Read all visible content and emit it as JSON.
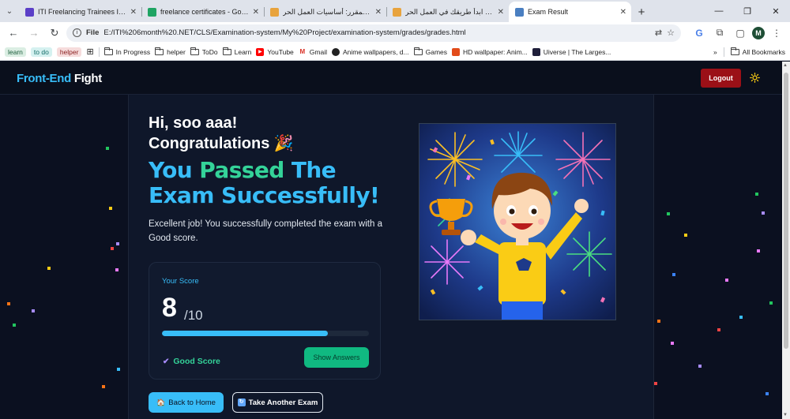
{
  "browser": {
    "tabs": [
      {
        "title": "ITI Freelancing Trainees Info an",
        "favicon_color": "#5b3fc7",
        "active": false
      },
      {
        "title": "freelance certificates - Google D",
        "favicon_color": "#1fa463",
        "active": false
      },
      {
        "title": "المقرر: أساسيات العمل الحر | Tech",
        "favicon_color": "#e8a33d",
        "active": false
      },
      {
        "title": "المقرر: ابدأ طريقك في العمل الحر",
        "favicon_color": "#e8a33d",
        "active": false
      },
      {
        "title": "Exam Result",
        "favicon_color": "#4a7fc1",
        "active": true
      }
    ],
    "address": {
      "scheme_label": "File",
      "url": "E:/ITI%206month%20.NET/CLS/Examination-system/My%20Project/examination-system/grades/grades.html"
    },
    "profile_initial": "M",
    "bookmarks": {
      "tags": [
        {
          "label": "learn",
          "bg": "#dbeee3",
          "fg": "#1a5c3a"
        },
        {
          "label": "to do",
          "bg": "#d5f1f0",
          "fg": "#136b67"
        },
        {
          "label": "helper",
          "bg": "#f6dcdc",
          "fg": "#8a1f1f"
        }
      ],
      "items": [
        {
          "label": "In Progress",
          "icon": "folder-icon"
        },
        {
          "label": "helper",
          "icon": "folder-icon"
        },
        {
          "label": "ToDo",
          "icon": "folder-icon"
        },
        {
          "label": "Learn",
          "icon": "folder-icon"
        },
        {
          "label": "YouTube",
          "icon": "youtube-icon",
          "color": "#ff0000"
        },
        {
          "label": "Gmail",
          "icon": "gmail-icon",
          "color": "#d93025"
        },
        {
          "label": "Anime wallpapers, d...",
          "icon": "site-icon",
          "color": "#222222"
        },
        {
          "label": "Games",
          "icon": "folder-icon"
        },
        {
          "label": "HD wallpaper: Anim...",
          "icon": "site-icon",
          "color": "#e24b1a"
        },
        {
          "label": "Uiverse | The Larges...",
          "icon": "site-icon",
          "color": "#1f1f3a"
        }
      ],
      "overflow_label": "»",
      "all_bookmarks": "All Bookmarks"
    }
  },
  "site": {
    "brand_part1": "Front-End",
    "brand_part2": "Fight",
    "logout_label": "Logout"
  },
  "result": {
    "greeting": "Hi, soo aaa!",
    "congrats": "Congratulations 🎉",
    "headline_word1": "You",
    "headline_word2": "Passed",
    "headline_rest": "The Exam Successfully!",
    "description": "Excellent job! You successfully completed the exam with a Good score.",
    "score_label": "Your Score",
    "score": "8",
    "total": "/10",
    "progress_fraction": 0.8,
    "rating": "Good Score",
    "show_answers_label": "Show Answers",
    "back_home_label": "Back to Home",
    "take_another_label": "Take Another Exam"
  },
  "colors": {
    "accent_blue": "#38bdf8",
    "accent_green": "#34d399",
    "logout_red": "#9b1017",
    "page_bg": "#0b1020"
  }
}
